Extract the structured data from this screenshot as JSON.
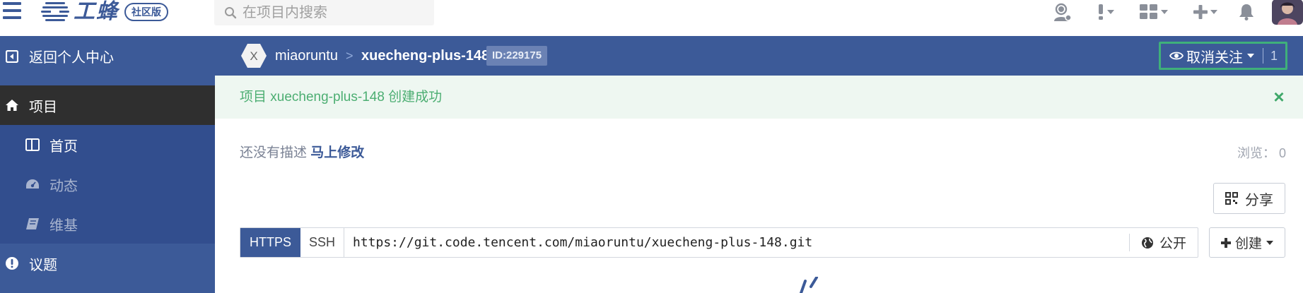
{
  "topbar": {
    "logo_text": "工蜂",
    "logo_badge": "社区版",
    "search_placeholder": "在项目内搜索",
    "icons": [
      "menu-icon",
      "support-agent-icon",
      "alert-icon",
      "apps-grid-icon",
      "plus-icon",
      "bell-icon",
      "user-avatar"
    ]
  },
  "sidebar": {
    "back_label": "返回个人中心",
    "project_label": "项目",
    "home_label": "首页",
    "activity_label": "动态",
    "wiki_label": "维基",
    "issues_label": "议题"
  },
  "project": {
    "avatar_letter": "X",
    "owner": "miaoruntu",
    "separator": ">",
    "repo": "xuecheng-plus-148",
    "id_badge": "ID:229175",
    "watch_label": "取消关注",
    "watch_count": "1"
  },
  "alert": {
    "message": "项目 xuecheng-plus-148 创建成功",
    "close": "×"
  },
  "description": {
    "prefix": "还没有描述",
    "edit_link": "马上修改",
    "views": "浏览：  0"
  },
  "share": {
    "label": "分享"
  },
  "clone": {
    "https_label": "HTTPS",
    "ssh_label": "SSH",
    "url": "https://git.code.tencent.com/miaoruntu/xuecheng-plus-148.git",
    "visibility": "公开"
  },
  "create": {
    "label": "创建"
  },
  "colors": {
    "brand": "#3c5a98",
    "active_nav": "#2f2f2f",
    "success": "#4cae72",
    "watch_border": "#3fb07a"
  }
}
